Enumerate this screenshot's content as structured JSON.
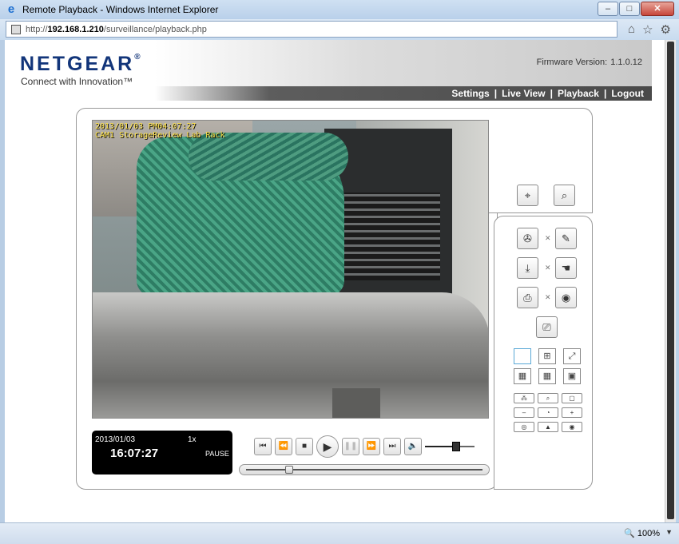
{
  "window": {
    "title": "Remote Playback - Windows Internet Explorer",
    "controls": [
      "–",
      "□",
      "✕"
    ]
  },
  "address": {
    "prefix": "http://",
    "host": "192.168.1.210",
    "path": "/surveillance/playback.php"
  },
  "header": {
    "logo": "NETGEAR",
    "logo_mark": "®",
    "tagline": "Connect with Innovation™",
    "firmware_label": "Firmware Version:",
    "firmware_value": "1.1.0.12"
  },
  "nav": {
    "sep": "|",
    "items": [
      {
        "label": "Settings"
      },
      {
        "label": "Live View"
      },
      {
        "label": "Playback"
      },
      {
        "label": "Logout"
      }
    ]
  },
  "video": {
    "osd_line1": "2013/01/03 PM04:07:27",
    "osd_line2": "CAM1 StorageReview Lab Rack"
  },
  "status": {
    "date": "2013/01/03",
    "speed": "1x",
    "time": "16:07:27",
    "state": "PAUSE"
  },
  "playback": {
    "volume_fraction": 0.65,
    "seek_fraction": 0.17
  },
  "icons": {
    "search": "binoculars-icon",
    "zoom": "magnify-icon"
  },
  "layout_glyphs": {
    "single": "",
    "quad": "⊞",
    "fullscreen": "⤢",
    "nine": "▦",
    "sixteen": "▦",
    "pip": "▣"
  },
  "small_buttons": {
    "row1": [
      "⁂",
      "⌕",
      "▢"
    ],
    "row2": [
      "–",
      "◔",
      "+"
    ],
    "row3": [
      "◎",
      "▲",
      "◉"
    ]
  },
  "statusbar": {
    "zoom": "100%"
  }
}
